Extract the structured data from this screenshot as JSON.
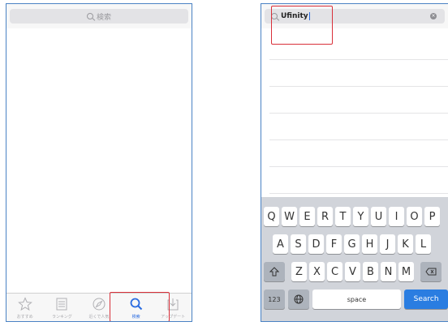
{
  "left_screen": {
    "search_placeholder": "検索",
    "tabs": [
      {
        "label": "おすすめ",
        "icon": "star-icon"
      },
      {
        "label": "ランキング",
        "icon": "list-icon"
      },
      {
        "label": "近くで人気",
        "icon": "compass-icon"
      },
      {
        "label": "検索",
        "icon": "search-icon",
        "active": true
      },
      {
        "label": "アップデート",
        "icon": "download-icon"
      }
    ]
  },
  "right_screen": {
    "search_value": "Ufinity",
    "keyboard": {
      "row1": [
        "Q",
        "W",
        "E",
        "R",
        "T",
        "Y",
        "U",
        "I",
        "O",
        "P"
      ],
      "row2": [
        "A",
        "S",
        "D",
        "F",
        "G",
        "H",
        "J",
        "K",
        "L"
      ],
      "row3": [
        "Z",
        "X",
        "C",
        "V",
        "B",
        "N",
        "M"
      ],
      "numbers_key": "123",
      "space_key": "space",
      "search_key": "Search"
    }
  },
  "colors": {
    "frame_border": "#4a82c4",
    "highlight": "#d9303a",
    "accent": "#2a6be0",
    "keyboard_bg": "#d1d4da"
  }
}
